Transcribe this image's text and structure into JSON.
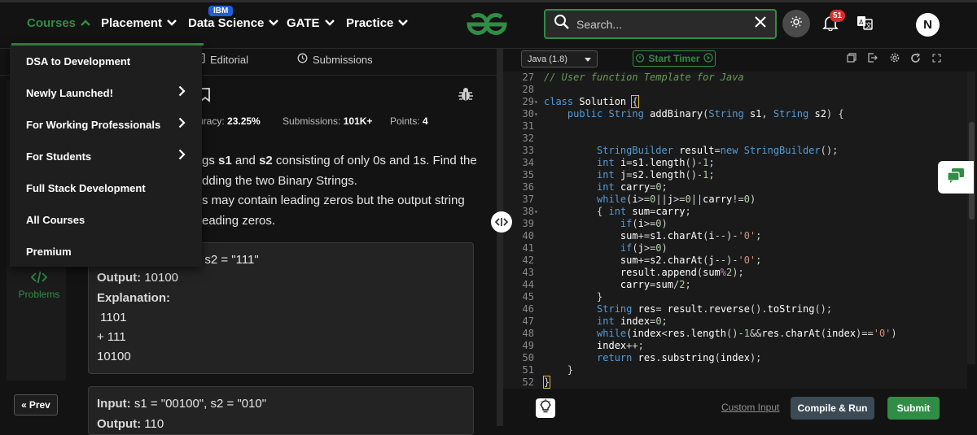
{
  "nav": {
    "items": [
      {
        "label": "Courses",
        "active": true
      },
      {
        "label": "Placement"
      },
      {
        "label": "Data Science"
      },
      {
        "label": "GATE"
      },
      {
        "label": "Practice"
      }
    ],
    "badge": "IBM",
    "search_placeholder": "Search...",
    "notification_count": "51",
    "avatar_initial": "N"
  },
  "dropdown": {
    "items": [
      {
        "label": "DSA to Development",
        "has_arrow": false
      },
      {
        "label": "Newly Launched!",
        "has_arrow": true
      },
      {
        "label": "For Working Professionals",
        "has_arrow": true
      },
      {
        "label": "For Students",
        "has_arrow": true
      },
      {
        "label": "Full Stack Development",
        "has_arrow": false
      },
      {
        "label": "All Courses",
        "has_arrow": false
      },
      {
        "label": "Premium",
        "has_arrow": false
      }
    ]
  },
  "problem": {
    "tabs": [
      "Editorial",
      "Submissions"
    ],
    "stats": {
      "accuracy_label": "uracy:",
      "accuracy_value": "23.25%",
      "submissions_label": "Submissions:",
      "submissions_value": "101K+",
      "points_label": "Points:",
      "points_value": "4"
    },
    "description_lines": [
      "gs s1 and s2 consisting of only 0s and 1s. Find the",
      "dding the two Binary Strings.",
      "s may contain leading zeros but the output string",
      "eading zeros."
    ],
    "example1": {
      "input_partial": ", s2 = \"111\"",
      "output_label": "Output:",
      "output_value": "10100",
      "explanation_label": "Explanation:",
      "lines": [
        " 1101",
        "+ 111",
        "10100"
      ]
    },
    "example2": {
      "input_label": "Input:",
      "input_value": " s1 = \"00100\", s2 = \"010\"",
      "output_label": "Output:",
      "output_value": " 110"
    },
    "problems_label": "Problems",
    "prev_label": "Prev"
  },
  "editor": {
    "language": "Java (1.8)",
    "timer_label": "Start Timer",
    "custom_input_label": "Custom Input",
    "compile_label": "Compile & Run",
    "submit_label": "Submit",
    "line_numbers": [
      "27",
      "28",
      "29",
      "30",
      "31",
      "32",
      "33",
      "34",
      "35",
      "36",
      "37",
      "38",
      "39",
      "40",
      "41",
      "42",
      "43",
      "44",
      "45",
      "46",
      "47",
      "48",
      "49",
      "50",
      "51",
      "52"
    ]
  },
  "colors": {
    "brand_green": "#2f8d46",
    "background": "#131313",
    "editor_bg": "#1a1a1a"
  }
}
